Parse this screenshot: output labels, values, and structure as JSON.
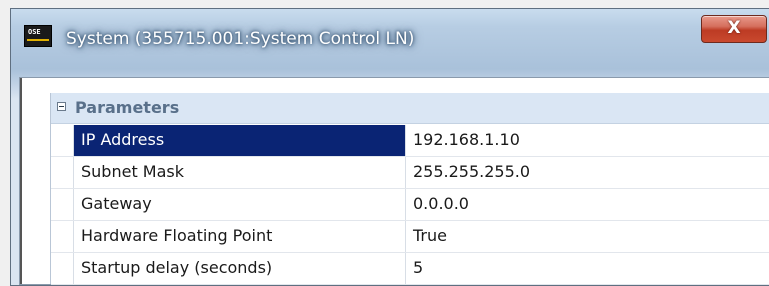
{
  "window": {
    "title": "System (355715.001:System Control LN)",
    "app_icon_text": "OSE",
    "close_glyph": "X"
  },
  "property_grid": {
    "category": {
      "label": "Parameters",
      "expanded": true
    },
    "properties": [
      {
        "name": "IP Address",
        "value": "192.168.1.10",
        "selected": true
      },
      {
        "name": "Subnet Mask",
        "value": "255.255.255.0",
        "selected": false
      },
      {
        "name": "Gateway",
        "value": "0.0.0.0",
        "selected": false
      },
      {
        "name": "Hardware Floating Point",
        "value": "True",
        "selected": false
      },
      {
        "name": "Startup delay (seconds)",
        "value": "5",
        "selected": false
      }
    ]
  },
  "colors": {
    "selection_bg": "#0a2474",
    "category_bg": "#dae6f4",
    "category_text": "#59708a",
    "close_button": "#c9492e"
  }
}
